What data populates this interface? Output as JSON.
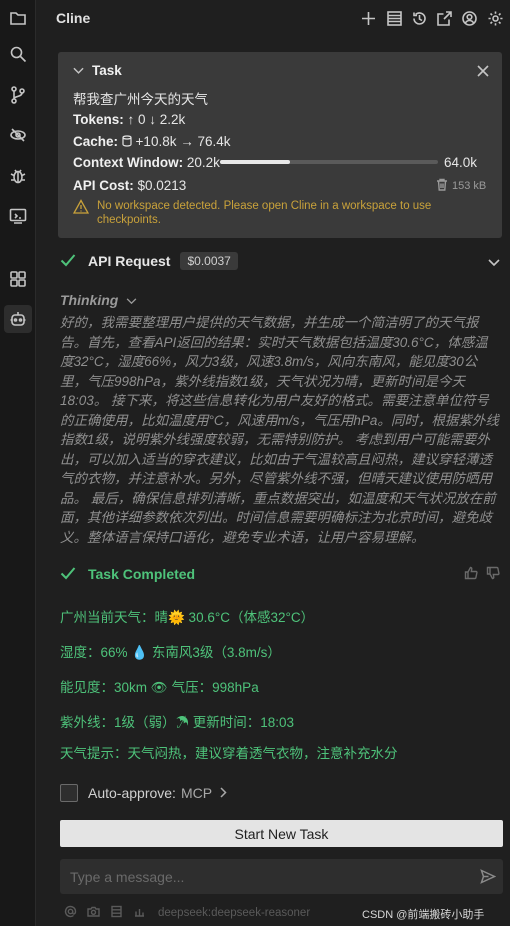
{
  "app": {
    "title": "Cline"
  },
  "header_icons": [
    "plus-icon",
    "list-icon",
    "history-icon",
    "popout-icon",
    "account-icon",
    "settings-icon"
  ],
  "task": {
    "header_label": "Task",
    "text": "帮我查广州今天的天气",
    "tokens_label": "Tokens:",
    "tokens_value": "↑ 0 ↓ 2.2k",
    "cache_label": "Cache:",
    "cache_value": "+10.8k → 76.4k",
    "context_label": "Context Window:",
    "context_used": "20.2k",
    "context_max": "64.0k",
    "context_fraction": 0.32,
    "api_cost_label": "API Cost:",
    "api_cost_value": "$0.0213",
    "size": "153 kB",
    "warning": "No workspace detected. Please open Cline in a workspace to use checkpoints."
  },
  "api_request": {
    "label": "API Request",
    "cost": "$0.0037"
  },
  "thinking": {
    "label": "Thinking",
    "text": "好的，我需要整理用户提供的天气数据，并生成一个简洁明了的天气报告。首先，查看API返回的结果：实时天气数据包括温度30.6°C，体感温度32°C，湿度66%，风力3级，风速3.8m/s，风向东南风，能见度30公里，气压998hPa，紫外线指数1级，天气状况为晴，更新时间是今天18:03。 接下来，将这些信息转化为用户友好的格式。需要注意单位符号的正确使用，比如温度用°C，风速用m/s，气压用hPa。同时，根据紫外线指数1级，说明紫外线强度较弱，无需特别防护。 考虑到用户可能需要外出，可以加入适当的穿衣建议，比如由于气温较高且闷热，建议穿轻薄透气的衣物，并注意补水。另外，尽管紫外线不强，但晴天建议使用防晒用品。 最后，确保信息排列清晰，重点数据突出，如温度和天气状况放在前面，其他详细参数依次列出。时间信息需要明确标注为北京时间，避免歧义。整体语言保持口语化，避免专业术语，让用户容易理解。"
  },
  "task_completed": {
    "label": "Task Completed",
    "lines": [
      "广州当前天气：晴🌞 30.6°C（体感32°C）",
      "湿度：66% 💧 东南风3级（3.8m/s）",
      "能见度：30km 👁 气压：998hPa",
      "紫外线：1级（弱）☂ 更新时间：18:03",
      "天气提示：天气闷热，建议穿着透气衣物，注意补充水分"
    ]
  },
  "auto_approve": {
    "label": "Auto-approve:",
    "value": "MCP"
  },
  "start_button": "Start New Task",
  "message_input": {
    "placeholder": "Type a message..."
  },
  "footer": {
    "model": "deepseek:deepseek-reasoner"
  },
  "watermark": "CSDN @前端搬砖小助手",
  "colors": {
    "accent_green": "#4ec27a",
    "warning": "#c9a23a",
    "background": "#1f1f1f",
    "card": "#3a3a3a"
  }
}
